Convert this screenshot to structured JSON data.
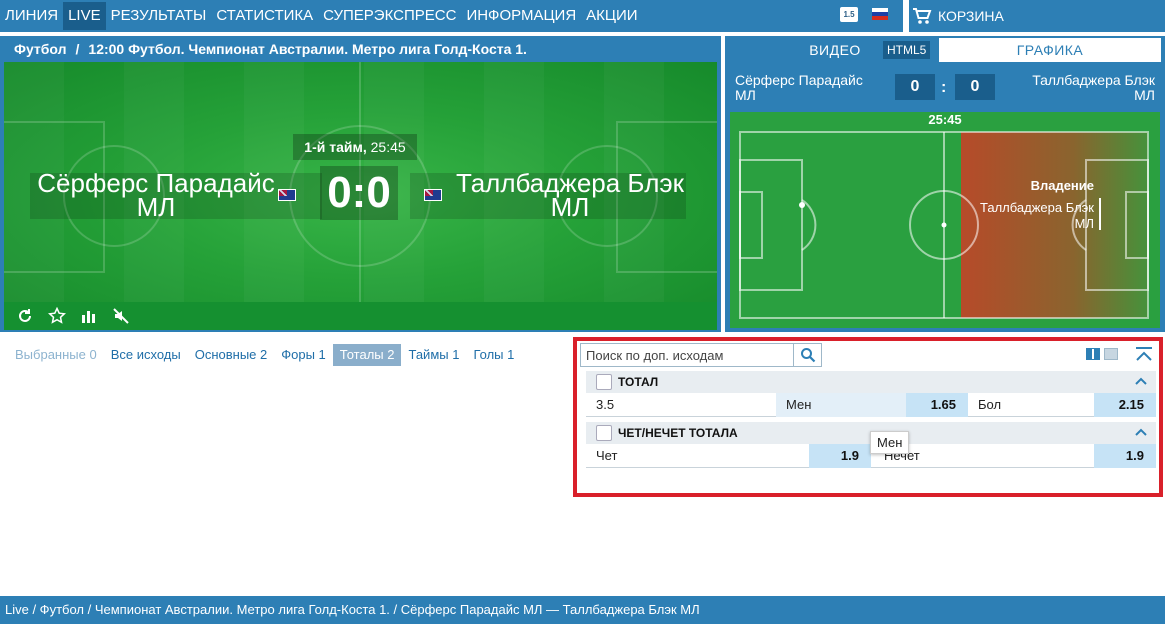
{
  "nav": {
    "items": [
      {
        "label": "ЛИНИЯ",
        "active": false
      },
      {
        "label": "LIVE",
        "active": true
      },
      {
        "label": "РЕЗУЛЬТАТЫ",
        "active": false
      },
      {
        "label": "СТАТИСТИКА",
        "active": false
      },
      {
        "label": "СУПЕРЭКСПРЕСС",
        "active": false
      },
      {
        "label": "ИНФОРМАЦИЯ",
        "active": false
      },
      {
        "label": "АКЦИИ",
        "active": false
      }
    ],
    "lang_badge": "1.5",
    "cart_label": "КОРЗИНА",
    "colors": {
      "bar": "#2d7fb5",
      "active": "#1a5e8c"
    }
  },
  "video": {
    "sport": "Футбол",
    "slash": "/",
    "event": "12:00 Футбол. Чемпионат Австралии. Метро лига Голд-Коста 1.",
    "half_label": "1-й тайм,",
    "time": "25:45",
    "score": "0:0",
    "team_home": "Сёрферс Парадайс МЛ",
    "team_away": "Таллбаджера Блэк МЛ"
  },
  "gfx": {
    "tab_video": "ВИДЕО",
    "tab_html5": "HTML5",
    "tab_graphics": "ГРАФИКА",
    "team_home_l1": "Сёрферс Парадайс",
    "team_home_l2": "МЛ",
    "team_away_l1": "Таллбаджера Блэк",
    "team_away_l2": "МЛ",
    "score_home": "0",
    "score_away": "0",
    "colon": ":",
    "time": "25:45",
    "possession_title": "Владение",
    "possession_team_l1": "Таллбаджера Блэк",
    "possession_team_l2": "МЛ"
  },
  "market_tabs": [
    {
      "label": "Выбранные 0",
      "state": "dim"
    },
    {
      "label": "Все исходы",
      "state": "normal"
    },
    {
      "label": "Основные 2",
      "state": "normal"
    },
    {
      "label": "Форы 1",
      "state": "normal"
    },
    {
      "label": "Тоталы 2",
      "state": "active"
    },
    {
      "label": "Таймы 1",
      "state": "normal"
    },
    {
      "label": "Голы 1",
      "state": "normal"
    }
  ],
  "search": {
    "placeholder": "Поиск по доп. исходам"
  },
  "markets": {
    "total": {
      "title": "ТОТАЛ",
      "line": "3.5",
      "under_label": "Мен",
      "under_odd": "1.65",
      "over_label": "Бол",
      "over_odd": "2.15"
    },
    "oddeven": {
      "title": "ЧЕТ/НЕЧЕТ ТОТАЛА",
      "even_label": "Чет",
      "even_odd": "1.9",
      "odd_label": "Нечет",
      "odd_odd": "1.9"
    },
    "tooltip": "Мен"
  },
  "footer": {
    "breadcrumb": "Live / Футбол / Чемпионат Австралии. Метро лига Голд-Коста 1. / Сёрферс Парадайс МЛ — Таллбаджера Блэк МЛ"
  }
}
